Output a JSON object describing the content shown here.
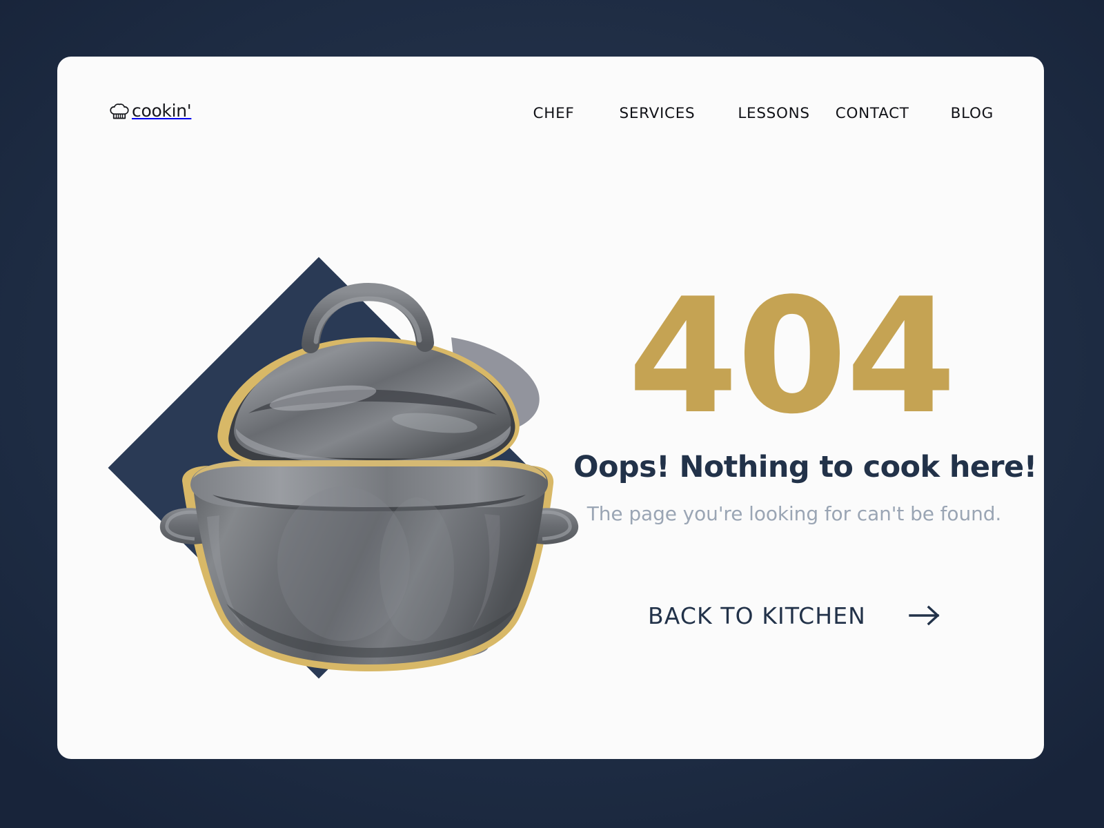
{
  "theme": {
    "page_background": "#1b2940",
    "card_background": "#fbfbfb",
    "navy": "#223249",
    "diamond_navy": "#2a3a55",
    "gold": "#c5a353",
    "muted_gray": "#9aa5b4",
    "pot_gray": "#6e7075"
  },
  "header": {
    "logo": {
      "icon": "chef-hat-icon",
      "text": "cookin'"
    },
    "nav": [
      {
        "label": "CHEF"
      },
      {
        "label": "SERVICES"
      },
      {
        "label": "LESSONS"
      },
      {
        "label": "CONTACT"
      },
      {
        "label": "BLOG"
      }
    ]
  },
  "illustration": {
    "shape": "diamond",
    "subject": "cooking-pot-with-lifted-lid"
  },
  "main": {
    "error_code": "404",
    "headline": "Oops! Nothing to cook here!",
    "subtitle": "The page you're looking for can't be found.",
    "cta": {
      "label": "BACK TO KITCHEN",
      "icon": "arrow-right-icon"
    }
  }
}
